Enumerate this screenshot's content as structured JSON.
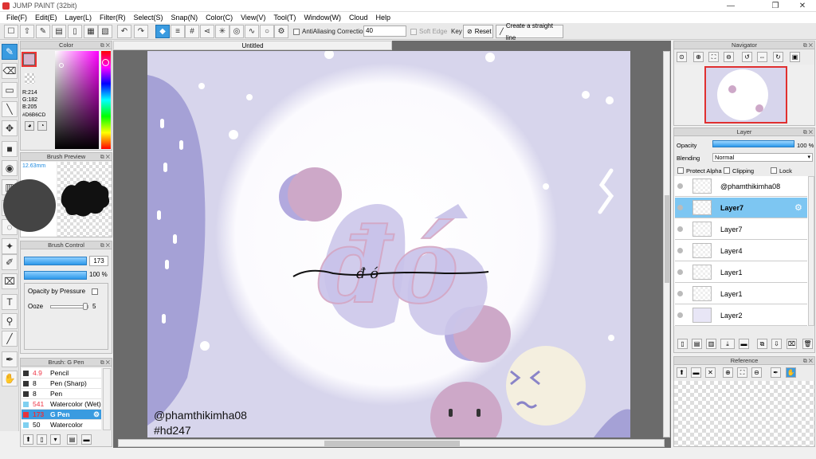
{
  "window": {
    "title": "JUMP PAINT (32bit)",
    "minimize": "—",
    "maximize": "❐",
    "close": "✕"
  },
  "menu": [
    "File(F)",
    "Edit(E)",
    "Layer(L)",
    "Filter(R)",
    "Select(S)",
    "Snap(N)",
    "Color(C)",
    "View(V)",
    "Tool(T)",
    "Window(W)",
    "Cloud",
    "Help"
  ],
  "toolbar": {
    "antialiasing_label": "AntiAliasing",
    "correction_label": "Correction",
    "correction_value": "40",
    "soft_edge_label": "Soft Edge",
    "key_label": "Key",
    "reset_label": "Reset",
    "straight_line_label": "Create a straight line"
  },
  "color_panel": {
    "title": "Color",
    "r": "R:214",
    "g": "G:182",
    "b": "B:205",
    "hex": "#D6B6CD",
    "main_color": "#D6B6CD"
  },
  "brush_preview": {
    "title": "Brush Preview",
    "size": "12.63mm"
  },
  "brush_control": {
    "title": "Brush Control",
    "size_value": "173",
    "opacity_value": "100 %",
    "opacity_by_pressure_label": "Opacity by Pressure",
    "ooze_label": "Ooze",
    "ooze_value": "5"
  },
  "brush_list": {
    "title": "Brush: G Pen",
    "items": [
      {
        "size": "4.9",
        "name": "Pencil",
        "color": "#333333"
      },
      {
        "size": "8",
        "name": "Pen (Sharp)",
        "color": "#333333"
      },
      {
        "size": "8",
        "name": "Pen",
        "color": "#333333"
      },
      {
        "size": "541",
        "name": "Watercolor (Wet)",
        "color": "#7fd0f0"
      },
      {
        "size": "173",
        "name": "G Pen",
        "color": "#e8333b"
      },
      {
        "size": "50",
        "name": "Watercolor",
        "color": "#7fd0f0"
      }
    ]
  },
  "document": {
    "tab_title": "Untitled"
  },
  "artwork": {
    "word": "đó",
    "signature": "đ ó",
    "credit": "@phamthikimha08",
    "hashtag": "#hd247"
  },
  "navigator": {
    "title": "Navigator"
  },
  "layer_panel": {
    "title": "Layer",
    "opacity_label": "Opacity",
    "opacity_value": "100 %",
    "opacity_fraction": 1.0,
    "blending_label": "Blending",
    "blending_value": "Normal",
    "protect_alpha_label": "Protect Alpha",
    "clipping_label": "Clipping",
    "lock_label": "Lock",
    "layers": [
      {
        "name": "@phamthikimha08",
        "bold": false,
        "selected": false
      },
      {
        "name": "Layer7",
        "bold": true,
        "selected": true
      },
      {
        "name": "Layer7",
        "bold": false,
        "selected": false
      },
      {
        "name": "Layer4",
        "bold": false,
        "selected": false
      },
      {
        "name": "Layer1",
        "bold": false,
        "selected": false
      },
      {
        "name": "Layer1",
        "bold": false,
        "selected": false
      },
      {
        "name": "Layer2",
        "bold": false,
        "selected": false
      }
    ]
  },
  "reference_panel": {
    "title": "Reference"
  }
}
